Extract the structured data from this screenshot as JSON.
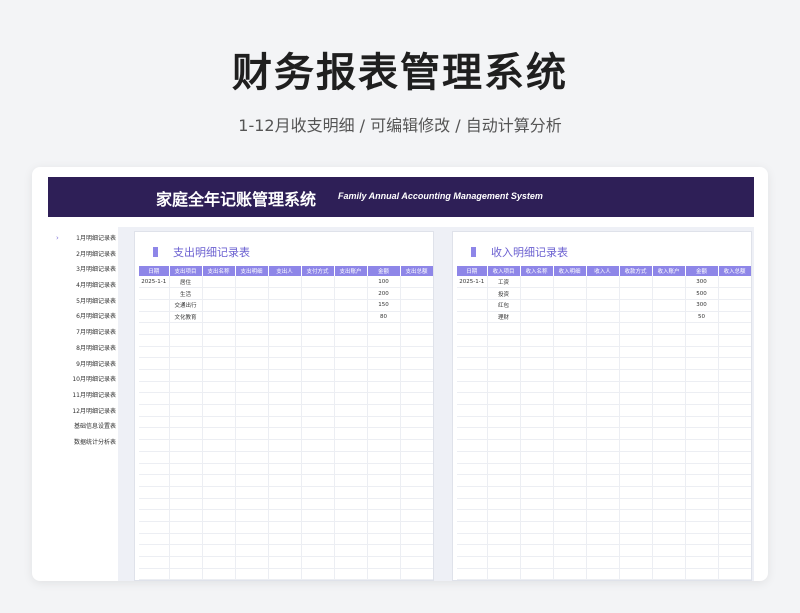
{
  "header": {
    "title": "财务报表管理系统",
    "subtitle": "1-12月收支明细 /  可编辑修改  /  自动计算分析"
  },
  "banner": {
    "title_cn": "家庭全年记账管理系统",
    "title_en": "Family Annual Accounting Management System"
  },
  "sidebar": {
    "items": [
      {
        "label": "1月明细记录表",
        "active": true
      },
      {
        "label": "2月明细记录表"
      },
      {
        "label": "3月明细记录表"
      },
      {
        "label": "4月明细记录表"
      },
      {
        "label": "5月明细记录表"
      },
      {
        "label": "6月明细记录表"
      },
      {
        "label": "7月明细记录表"
      },
      {
        "label": "8月明细记录表"
      },
      {
        "label": "9月明细记录表"
      },
      {
        "label": "10月明细记录表"
      },
      {
        "label": "11月明细记录表"
      },
      {
        "label": "12月明细记录表"
      },
      {
        "label": "基础信息设置表"
      },
      {
        "label": "数据统计分析表"
      }
    ]
  },
  "expense": {
    "title": "支出明细记录表",
    "columns": [
      "日期",
      "支出项目",
      "支出名称",
      "支出明细",
      "支出人",
      "支付方式",
      "支出账户",
      "金额",
      "支出总额"
    ],
    "rows": [
      [
        "2025-1-1",
        "居住",
        "",
        "",
        "",
        "",
        "",
        "100",
        ""
      ],
      [
        "",
        "生活",
        "",
        "",
        "",
        "",
        "",
        "200",
        ""
      ],
      [
        "",
        "交通出行",
        "",
        "",
        "",
        "",
        "",
        "150",
        ""
      ],
      [
        "",
        "文化教育",
        "",
        "",
        "",
        "",
        "",
        "80",
        ""
      ]
    ]
  },
  "income": {
    "title": "收入明细记录表",
    "columns": [
      "日期",
      "收入项目",
      "收入名称",
      "收入明细",
      "收入人",
      "收款方式",
      "收入账户",
      "金额",
      "收入总额"
    ],
    "rows": [
      [
        "2025-1-1",
        "工资",
        "",
        "",
        "",
        "",
        "",
        "300",
        ""
      ],
      [
        "",
        "投资",
        "",
        "",
        "",
        "",
        "",
        "500",
        ""
      ],
      [
        "",
        "红包",
        "",
        "",
        "",
        "",
        "",
        "300",
        ""
      ],
      [
        "",
        "理财",
        "",
        "",
        "",
        "",
        "",
        "50",
        ""
      ]
    ]
  },
  "colors": {
    "banner": "#2e1f57",
    "accent": "#8e86e8",
    "title_accent": "#6a5fd0"
  }
}
